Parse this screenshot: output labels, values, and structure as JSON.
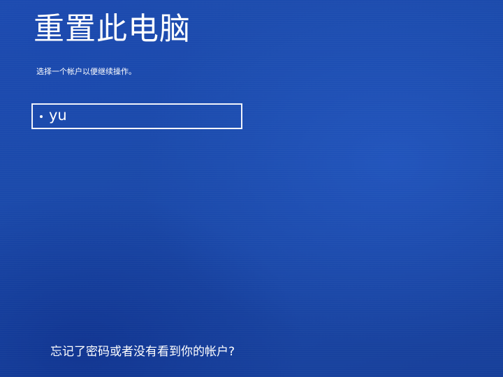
{
  "page": {
    "title": "重置此电脑",
    "instruction": "选择一个帐户以便继续操作。"
  },
  "accounts": [
    {
      "name": "yu",
      "icon": "bullet-icon"
    }
  ],
  "footer": {
    "help_link": "忘记了密码或者没有看到你的帐户?"
  },
  "colors": {
    "background": "#1d4fae",
    "text": "#ffffff",
    "account_border": "#f2f4fb"
  }
}
